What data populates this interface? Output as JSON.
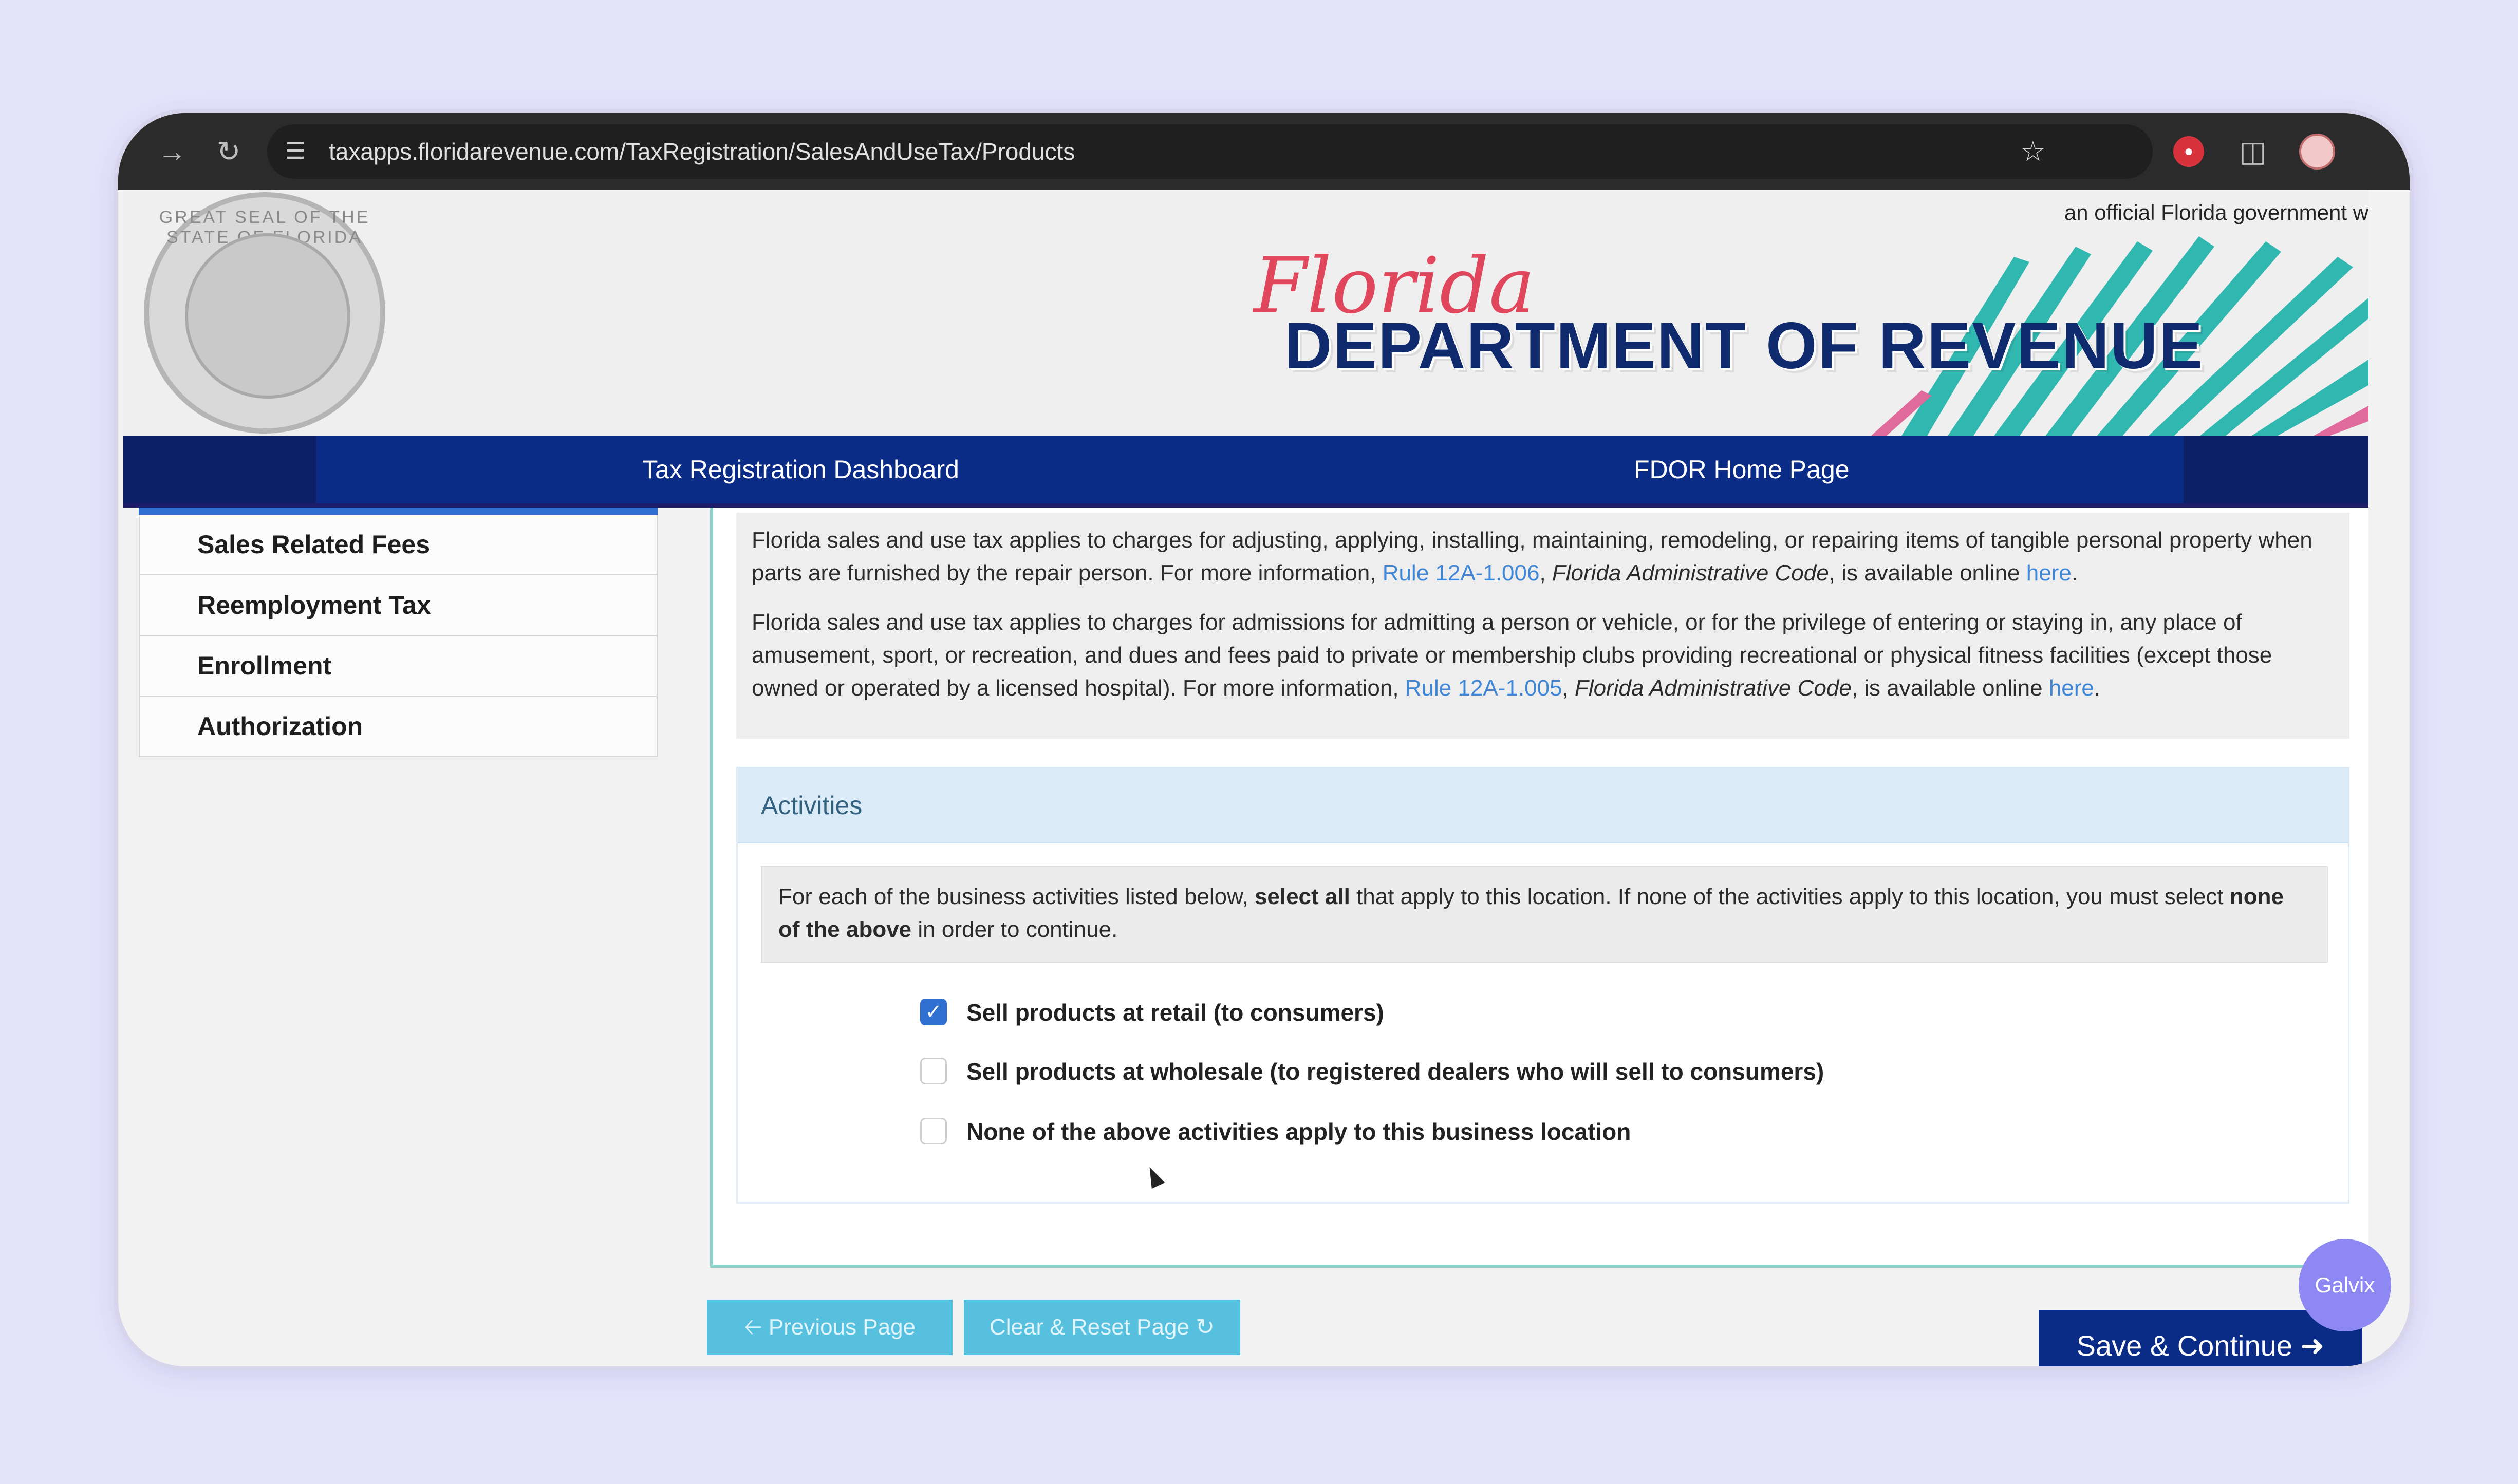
{
  "browser": {
    "url": "taxapps.floridarevenue.com/TaxRegistration/SalesAndUseTax/Products",
    "icons": [
      "forward-icon",
      "reload-icon",
      "site-settings-icon",
      "bookmark-star-icon",
      "extension-icon",
      "puzzle-icon",
      "profile-avatar"
    ]
  },
  "header": {
    "official_notice": "an official Florida government w",
    "florida_script": "Florida",
    "department_title": "DEPARTMENT OF REVENUE",
    "seal_text": "GREAT SEAL OF THE STATE OF FLORIDA"
  },
  "nav": {
    "dashboard": "Tax Registration Dashboard",
    "home": "FDOR Home Page"
  },
  "sidebar": {
    "items": [
      {
        "label": "Sales Related Fees"
      },
      {
        "label": "Reemployment Tax"
      },
      {
        "label": "Enrollment"
      },
      {
        "label": "Authorization"
      }
    ]
  },
  "info": {
    "p1_text": "Florida sales and use tax applies to charges for adjusting, applying, installing, maintaining, remodeling, or repairing items of tangible personal property when parts are furnished by the repair person. For more information, ",
    "p1_rule": "Rule 12A-1.006",
    "p1_sep": ", ",
    "p1_code": "Florida Administrative Code",
    "p1_after": ", is available online ",
    "p1_here": "here",
    "p1_end": ".",
    "p2_text": "Florida sales and use tax applies to charges for admissions for admitting a person or vehicle, or for the privilege of entering or staying in, any place of amusement, sport, or recreation, and dues and fees paid to private or membership clubs providing recreational or physical fitness facilities (except those owned or operated by a licensed hospital). For more information, ",
    "p2_rule": "Rule 12A-1.005",
    "p2_sep": ", ",
    "p2_code": "Florida Administrative Code",
    "p2_after": ", is available online ",
    "p2_here": "here",
    "p2_end": "."
  },
  "activities": {
    "heading": "Activities",
    "instr_a": "For each of the business activities listed below, ",
    "instr_b": "select all",
    "instr_c": " that apply to this location. If none of the activities apply to this location, you must select ",
    "instr_d": "none of the above",
    "instr_e": " in order to continue.",
    "options": [
      {
        "label": "Sell products at retail (to consumers)",
        "checked": true
      },
      {
        "label": "Sell products at wholesale (to registered dealers who will sell to consumers)",
        "checked": false
      },
      {
        "label": "None of the above activities apply to this business location",
        "checked": false
      }
    ]
  },
  "buttons": {
    "previous": "Previous Page",
    "clear": "Clear & Reset Page",
    "save": "Save & Continue"
  },
  "badge": {
    "label": "Galvix"
  },
  "colors": {
    "nav_blue": "#0a2b86",
    "button_cyan": "#57c0df",
    "link_blue": "#3f86d6",
    "accent_teal": "#8fd2c9"
  }
}
